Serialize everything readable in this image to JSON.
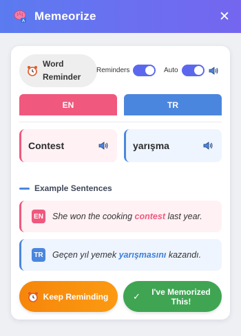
{
  "header": {
    "title": "Memeorize",
    "logo_icon": "brain-icon",
    "close_icon": "close-icon",
    "gradient_start": "#5b7bf0",
    "gradient_end": "#7466ef"
  },
  "controls": {
    "word_reminder_label": "Word Reminder",
    "reminders_label": "Reminders",
    "reminders_on": true,
    "auto_label": "Auto",
    "auto_on": true
  },
  "tabs": [
    {
      "label": "EN",
      "color": "#f0587e"
    },
    {
      "label": "TR",
      "color": "#4b86de"
    }
  ],
  "words": {
    "source": "Contest",
    "target": "yarışma"
  },
  "examples": {
    "title": "Example Sentences",
    "items": [
      {
        "badge": "EN",
        "before": "She won the cooking ",
        "highlight": "contest",
        "after": " last year.",
        "accent": "#f0587e"
      },
      {
        "badge": "TR",
        "before": "Geçen yıl yemek ",
        "highlight": "yarışmasını",
        "after": " kazandı.",
        "accent": "#3f7fd9"
      }
    ]
  },
  "actions": {
    "keep_reminding": "Keep Reminding",
    "memorized": "I've Memorized This!",
    "keep_color": "#f6860b",
    "memorized_color": "#3fa553"
  }
}
